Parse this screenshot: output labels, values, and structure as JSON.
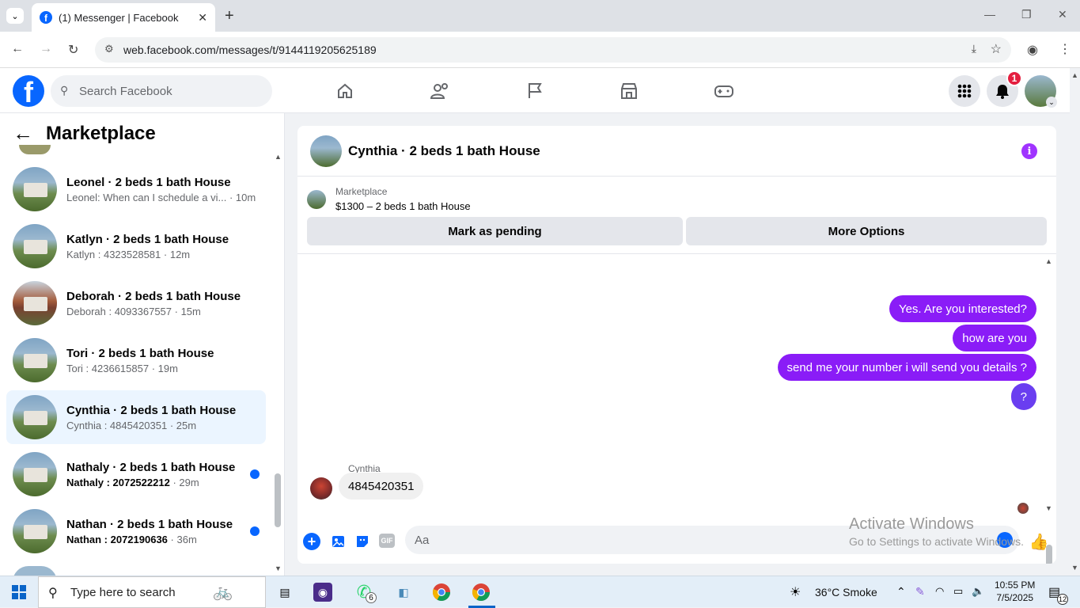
{
  "browser": {
    "tab_title": "(1) Messenger | Facebook",
    "url": "web.facebook.com/messages/t/9144119205625189"
  },
  "fb": {
    "search_placeholder": "Search Facebook",
    "notification_count": "1"
  },
  "sidebar": {
    "title": "Marketplace",
    "conversations": [
      {
        "name": "Leonel · 2 beds 1 bath House",
        "preview": "Leonel: When can I schedule a vi...",
        "time": "· 10m",
        "unread": false
      },
      {
        "name": "Katlyn · 2 beds 1 bath House",
        "preview": "Katlyn : 4323528581",
        "time": "· 12m",
        "unread": false
      },
      {
        "name": "Deborah · 2 beds 1 bath House",
        "preview": "Deborah : 4093367557",
        "time": "· 15m",
        "unread": false
      },
      {
        "name": "Tori · 2 beds 1 bath House",
        "preview": "Tori : 4236615857",
        "time": "· 19m",
        "unread": false
      },
      {
        "name": "Cynthia · 2 beds 1 bath House",
        "preview": "Cynthia : 4845420351",
        "time": "· 25m",
        "unread": false,
        "active": true
      },
      {
        "name": "Nathaly · 2 beds 1 bath House",
        "preview": "Nathaly : 2072522212",
        "time": "· 29m",
        "unread": true
      },
      {
        "name": "Nathan · 2 beds 1 bath House",
        "preview": "Nathan : 2072190636",
        "time": "· 36m",
        "unread": true
      }
    ]
  },
  "chat": {
    "title": "Cynthia · 2 beds 1 bath House",
    "marketplace_label": "Marketplace",
    "listing": "$1300 – 2 beds 1 bath House",
    "mark_pending": "Mark as pending",
    "more_options": "More Options",
    "outgoing": [
      "Yes. Are you interested?",
      "how are you",
      "send me your number i will send you details ?",
      "?"
    ],
    "sender_name": "Cynthia",
    "incoming": "4845420351",
    "input_placeholder": "Aa"
  },
  "watermark": {
    "line1": "Activate Windows",
    "line2": "Go to Settings to activate Windows."
  },
  "taskbar": {
    "search_placeholder": "Type here to search",
    "weather": "36°C  Smoke",
    "time": "10:55 PM",
    "date": "7/5/2025",
    "whatsapp_badge": "6",
    "notifications": "12"
  },
  "colors": {
    "fb_blue": "#0866ff",
    "bubble_purple": "#8a1cf7",
    "active_row": "#ebf5ff"
  }
}
